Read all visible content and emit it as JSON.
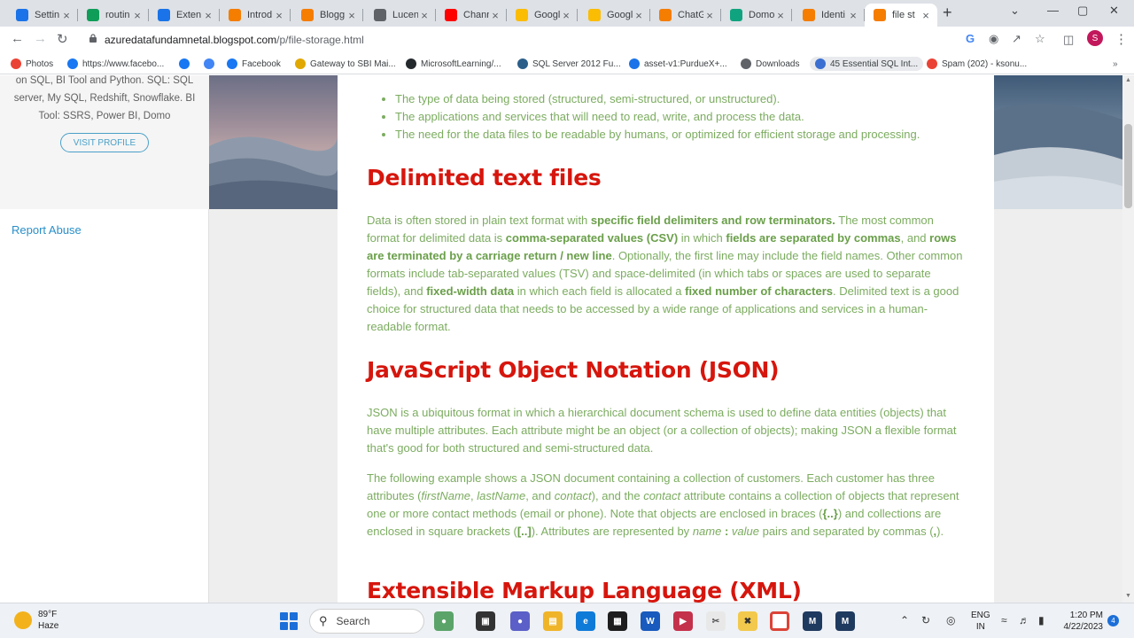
{
  "browser": {
    "tabs": [
      {
        "label": "Settin",
        "icon": "gear-icon",
        "color": "#1a73e8"
      },
      {
        "label": "routin",
        "icon": "sheets-icon",
        "color": "#0f9d58"
      },
      {
        "label": "Exten",
        "icon": "puzzle-icon",
        "color": "#1a73e8"
      },
      {
        "label": "Introd",
        "icon": "blogger-icon",
        "color": "#f57d00"
      },
      {
        "label": "Blogg",
        "icon": "blogger-icon",
        "color": "#f57d00"
      },
      {
        "label": "Lucen",
        "icon": "globe-icon",
        "color": "#5f6368"
      },
      {
        "label": "Chann",
        "icon": "youtube-icon",
        "color": "#ff0000"
      },
      {
        "label": "Googl",
        "icon": "keep-icon",
        "color": "#fbbc04"
      },
      {
        "label": "Googl",
        "icon": "keep-icon",
        "color": "#fbbc04"
      },
      {
        "label": "ChatG",
        "icon": "blogger-icon",
        "color": "#f57d00"
      },
      {
        "label": "Domo",
        "icon": "openai-icon",
        "color": "#10a37f"
      },
      {
        "label": "Identi",
        "icon": "blogger-icon",
        "color": "#f57d00"
      },
      {
        "label": "file st",
        "icon": "blogger-icon",
        "color": "#f57d00",
        "active": true
      }
    ],
    "url_host": "azuredatafundamnetal.blogspot.com",
    "url_path": "/p/file-storage.html",
    "profile_initial": "S",
    "bookmarks": [
      {
        "label": "Photos",
        "icon": "photos-icon",
        "color": "#ea4335"
      },
      {
        "label": "https://www.facebo...",
        "icon": "facebook-icon",
        "color": "#1877f2"
      },
      {
        "label": "",
        "icon": "facebook-icon",
        "color": "#1877f2"
      },
      {
        "label": "",
        "icon": "google-icon",
        "color": "#4285f4"
      },
      {
        "label": "Facebook",
        "icon": "facebook-icon",
        "color": "#1877f2"
      },
      {
        "label": "Gateway to SBI Mai...",
        "icon": "sbi-icon",
        "color": "#e0a800"
      },
      {
        "label": "MicrosoftLearning/...",
        "icon": "github-icon",
        "color": "#24292e"
      },
      {
        "label": "SQL Server 2012 Fu...",
        "icon": "sqlserver-icon",
        "color": "#2b5f8a"
      },
      {
        "label": "asset-v1:PurdueX+...",
        "icon": "circle-icon",
        "color": "#1a73e8"
      },
      {
        "label": "Downloads",
        "icon": "download-icon",
        "color": "#5f6368"
      },
      {
        "label": "45 Essential SQL Int...",
        "icon": "bookmark-icon",
        "color": "#3b6fd1",
        "active": true
      },
      {
        "label": "Spam (202) - ksonu...",
        "icon": "gmail-icon",
        "color": "#ea4335"
      }
    ]
  },
  "sidebar": {
    "bio_lines": [
      "on SQL, BI Tool and Python. SQL: SQL",
      "server, My SQL, Redshift, Snowflake. BI",
      "Tool: SSRS, Power BI, Domo"
    ],
    "visit_profile": "VISIT PROFILE",
    "report_abuse": "Report Abuse"
  },
  "article": {
    "bullets": [
      "The type of data being stored (structured, semi-structured, or unstructured).",
      "The applications and services that will need to read, write, and process the data.",
      "The need for the data files to be readable by humans, or optimized for efficient storage and processing."
    ],
    "h_delimited": "Delimited text files",
    "delim": {
      "t1": "Data is often stored in plain text format with ",
      "b1": "specific field delimiters and row terminators.",
      "t2": " The most common format for delimited data is ",
      "b2": "comma-separated values (CSV)",
      "t3": " in which ",
      "b3": "fields are separated by commas",
      "t4": ", and ",
      "b4": "rows are terminated by a carriage return / new line",
      "t5": ". Optionally, the first line may include the field names. Other common formats include tab-separated values (TSV) and space-delimited (in which tabs or spaces are used to separate fields), and ",
      "b5": "fixed-width data",
      "t6": " in which each field is allocated a ",
      "b6": "fixed number of characters",
      "t7": ". Delimited text is a good choice for structured data that needs to be accessed by a wide range of applications and services in a human-readable format."
    },
    "h_json": "JavaScript Object Notation (JSON)",
    "json_p1": "JSON is a ubiquitous format in which a hierarchical document schema is used to define data entities (objects) that have multiple attributes. Each attribute might be an object (or a collection of objects); making JSON a flexible format that's good for both structured and semi-structured data.",
    "json_p2": {
      "t1": "The following example shows a JSON document containing a collection of customers. Each customer has three attributes (",
      "i1": "firstName",
      "t2": ", ",
      "i2": "lastName",
      "t3": ", and ",
      "i3": "contact",
      "t4": "), and the ",
      "i4": "contact",
      "t5": " attribute contains a collection of objects that represent one or more contact methods (email or phone). Note that objects are enclosed in braces (",
      "b1": "{..}",
      "t6": ") and collections are enclosed in square brackets (",
      "b2": "[..]",
      "t7": "). Attributes are represented by ",
      "i5": "name",
      "b3": " : ",
      "i6": "value",
      "t8": " pairs and separated by commas (",
      "b4": ",",
      "t9": ")."
    },
    "h_xml": "Extensible Markup Language (XML)"
  },
  "taskbar": {
    "temperature": "89°F",
    "condition": "Haze",
    "search_label": "Search",
    "lang_line1": "ENG",
    "lang_line2": "IN",
    "time": "1:20 PM",
    "date": "4/22/2023",
    "notification_count": "4"
  }
}
